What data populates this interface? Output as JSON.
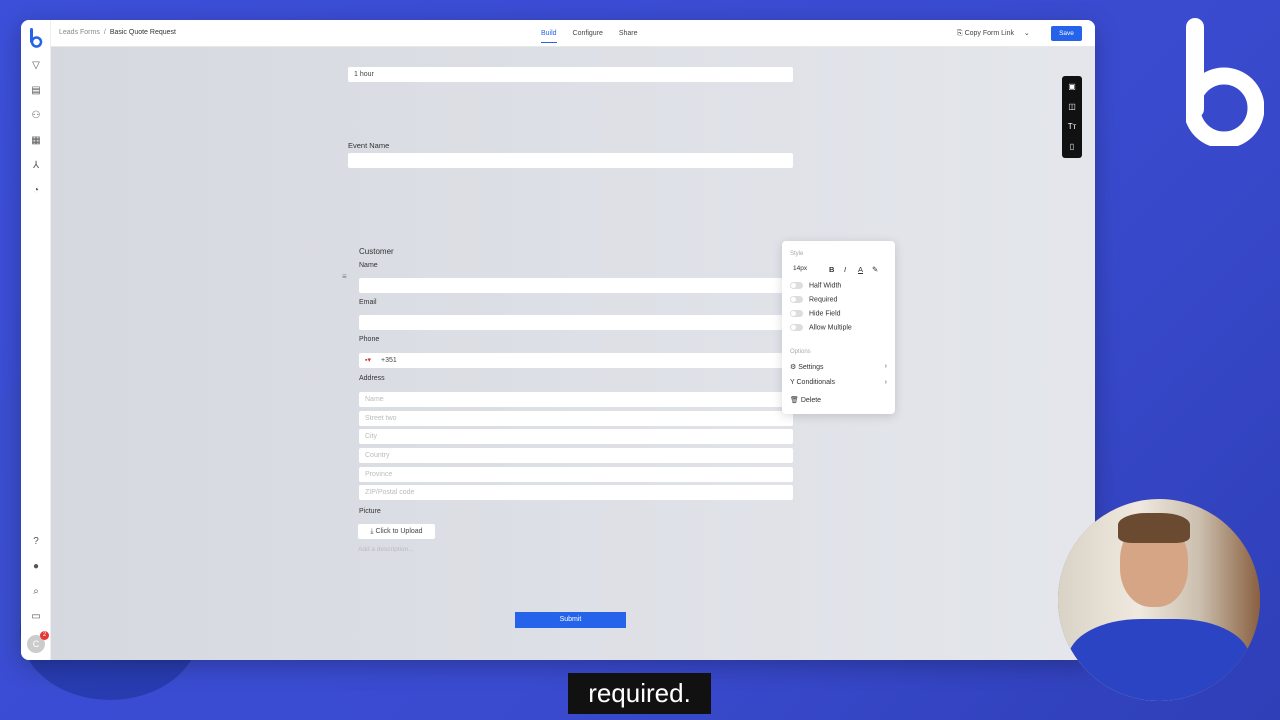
{
  "breadcrumb": {
    "parent": "Leads Forms",
    "separator": "/",
    "current": "Basic Quote Request"
  },
  "tabs": [
    {
      "label": "Build"
    },
    {
      "label": "Configure"
    },
    {
      "label": "Share"
    }
  ],
  "toolbar": {
    "copy_link_label": "Copy Form Link",
    "save_label": "Save"
  },
  "form": {
    "duration_value": "1 hour",
    "event_name_label": "Event Name",
    "customer_title": "Customer",
    "name_label": "Name",
    "email_label": "Email",
    "phone_label": "Phone",
    "phone_value": "+351",
    "address_label": "Address",
    "address_placeholders": {
      "name": "Name",
      "street_two": "Street two",
      "city": "City",
      "country": "Country",
      "province": "Province",
      "zip": "ZIP/Postal code"
    },
    "picture_label": "Picture",
    "upload_label": "Click to Upload",
    "description_placeholder": "Add a description...",
    "submit_label": "Submit"
  },
  "field_menu": {
    "style_header": "Style",
    "font_size": "14px",
    "format_buttons": [
      "B",
      "I",
      "A"
    ],
    "toggles": [
      {
        "label": "Half Width",
        "on": false
      },
      {
        "label": "Required",
        "on": false
      },
      {
        "label": "Hide Field",
        "on": false
      },
      {
        "label": "Allow Multiple",
        "on": false
      }
    ],
    "options_header": "Options",
    "options": [
      {
        "label": "Settings"
      },
      {
        "label": "Conditionals"
      },
      {
        "label": "Delete"
      }
    ]
  },
  "caption": "required.",
  "colors": {
    "accent": "#2563eb",
    "background": "#3b4fd8"
  }
}
